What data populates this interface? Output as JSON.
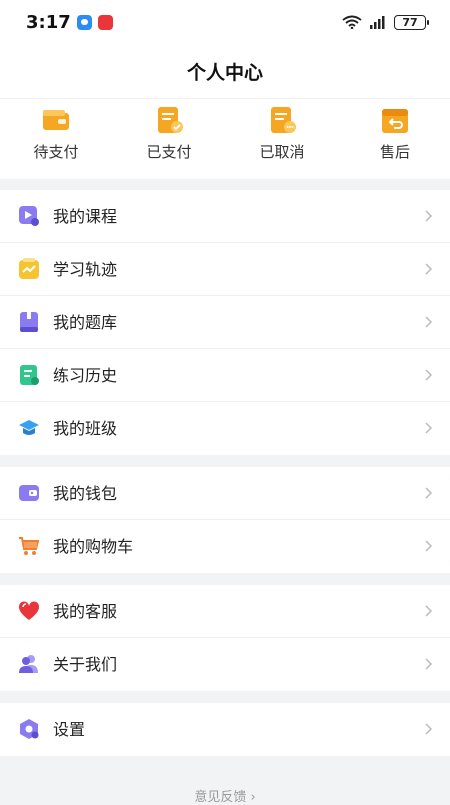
{
  "status_bar": {
    "time": "3:17",
    "battery": "77"
  },
  "header": {
    "title": "个人中心"
  },
  "orders": [
    {
      "label": "待支付",
      "icon": "wallet-icon"
    },
    {
      "label": "已支付",
      "icon": "paid-order-icon"
    },
    {
      "label": "已取消",
      "icon": "cancelled-order-icon"
    },
    {
      "label": "售后",
      "icon": "after-sales-icon"
    }
  ],
  "menu_group_1": [
    {
      "label": "我的课程",
      "icon": "course-video-icon"
    },
    {
      "label": "学习轨迹",
      "icon": "learning-trend-icon"
    },
    {
      "label": "我的题库",
      "icon": "question-bank-icon"
    },
    {
      "label": "练习历史",
      "icon": "practice-history-icon"
    },
    {
      "label": "我的班级",
      "icon": "graduation-cap-icon"
    }
  ],
  "menu_group_2": [
    {
      "label": "我的钱包",
      "icon": "wallet-card-icon"
    },
    {
      "label": "我的购物车",
      "icon": "shopping-cart-icon"
    }
  ],
  "menu_group_3": [
    {
      "label": "我的客服",
      "icon": "heart-service-icon"
    },
    {
      "label": "关于我们",
      "icon": "users-icon"
    }
  ],
  "menu_group_4": [
    {
      "label": "设置",
      "icon": "settings-hexagon-icon"
    }
  ],
  "footer": {
    "feedback": "意见反馈 ›"
  },
  "colors": {
    "accent_orange": "#f5a623",
    "purple": "#8a7cf0",
    "background": "#f2f3f5"
  }
}
